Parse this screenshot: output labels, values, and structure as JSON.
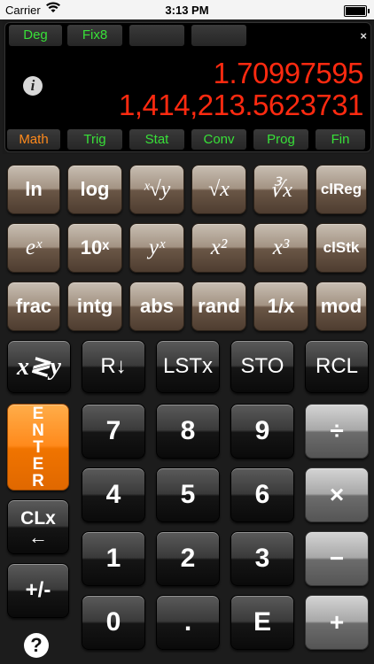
{
  "status_bar": {
    "carrier": "Carrier",
    "time": "3:13 PM"
  },
  "display": {
    "modes": [
      "Deg",
      "Fix8",
      "",
      ""
    ],
    "line_x": "1.70997595",
    "line_y": "1,414,213.5623731",
    "close_symbol": "×",
    "info_symbol": "i",
    "categories": [
      "Math",
      "Trig",
      "Stat",
      "Conv",
      "Prog",
      "Fin"
    ],
    "active_category": "Math"
  },
  "keys": {
    "row1": [
      "ln",
      "log",
      "ˣ√y",
      "√x",
      "∛x",
      "clReg"
    ],
    "row2": [
      "eˣ",
      "10ˣ",
      "yˣ",
      "x²",
      "x³",
      "clStk"
    ],
    "row3": [
      "frac",
      "intg",
      "abs",
      "rand",
      "1/x",
      "mod"
    ],
    "row4": [
      "x≷y",
      "R↓",
      "LSTx",
      "STO",
      "RCL"
    ],
    "enter": [
      "E",
      "N",
      "T",
      "E",
      "R"
    ],
    "clx": "CLx",
    "clx_arrow": "←",
    "chs": "+/-",
    "digits": [
      "7",
      "8",
      "9",
      "4",
      "5",
      "6",
      "1",
      "2",
      "3",
      "0",
      ".",
      "E"
    ],
    "ops": [
      "÷",
      "×",
      "−",
      "+"
    ],
    "help": "?"
  },
  "colors": {
    "display_red": "#ff2a10",
    "mode_green": "#38e038",
    "active_orange": "#ff8a1c"
  }
}
